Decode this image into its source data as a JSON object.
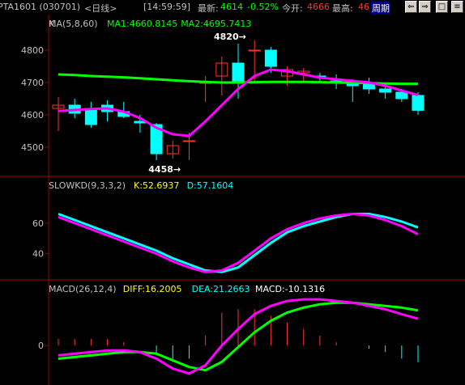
{
  "header": {
    "symbol": "PTA1601 (030701)",
    "period": "<日线>",
    "time": "[14:59:59]",
    "last_label": "最新:",
    "last_value": "4614",
    "change_pct": "-0.52%",
    "open_label": "今开:",
    "open_value": "4666",
    "high_label": "最高:",
    "high_value": "46",
    "period_button": "周期"
  },
  "colors": {
    "up": "#ff3232",
    "down": "#00ffff",
    "ma1": "#ff00ff",
    "ma2": "#00ff00",
    "k": "#ff00ff",
    "d": "#00ffff",
    "diff": "#ff00ff",
    "dea": "#00ff00",
    "axis": "#a00000"
  },
  "chart_data": [
    {
      "type": "candlestick",
      "title": "K",
      "indicator_label": "MA(5,8,60)",
      "legend": [
        {
          "name": "MA1",
          "text": "MA1:4660.8145"
        },
        {
          "name": "MA2",
          "text": "MA2:4695.7413"
        }
      ],
      "ylim": [
        4420,
        4860
      ],
      "yticks": [
        4500,
        4600,
        4700,
        4800
      ],
      "annotations": [
        {
          "text": "4820→",
          "value": 4820
        },
        {
          "text": "4458→",
          "value": 4458
        }
      ],
      "candles": [
        [
          4620,
          4655,
          4550,
          4630
        ],
        [
          4630,
          4650,
          4590,
          4605
        ],
        [
          4620,
          4640,
          4560,
          4570
        ],
        [
          4630,
          4645,
          4580,
          4610
        ],
        [
          4610,
          4640,
          4590,
          4595
        ],
        [
          4580,
          4600,
          4545,
          4575
        ],
        [
          4570,
          4575,
          4460,
          4480
        ],
        [
          4480,
          4520,
          4465,
          4505
        ],
        [
          4520,
          4545,
          4460,
          4520
        ],
        [
          4700,
          4720,
          4640,
          4700
        ],
        [
          4720,
          4780,
          4660,
          4760
        ],
        [
          4760,
          4820,
          4650,
          4700
        ],
        [
          4800,
          4830,
          4700,
          4800
        ],
        [
          4800,
          4810,
          4730,
          4750
        ],
        [
          4720,
          4750,
          4690,
          4740
        ],
        [
          4730,
          4745,
          4700,
          4735
        ],
        [
          4720,
          4730,
          4700,
          4715
        ],
        [
          4705,
          4725,
          4680,
          4700
        ],
        [
          4695,
          4710,
          4640,
          4690
        ],
        [
          4700,
          4715,
          4665,
          4680
        ],
        [
          4680,
          4690,
          4650,
          4670
        ],
        [
          4670,
          4680,
          4640,
          4650
        ],
        [
          4660,
          4670,
          4600,
          4614
        ]
      ],
      "ma1": [
        4612,
        4615,
        4618,
        4620,
        4610,
        4590,
        4560,
        4540,
        4535,
        4580,
        4630,
        4680,
        4720,
        4740,
        4735,
        4725,
        4715,
        4710,
        4705,
        4700,
        4690,
        4675,
        4661
      ],
      "ma2": [
        4725,
        4723,
        4720,
        4718,
        4716,
        4713,
        4710,
        4707,
        4704,
        4702,
        4700,
        4700,
        4701,
        4702,
        4702,
        4702,
        4701,
        4700,
        4699,
        4698,
        4697,
        4696,
        4696
      ]
    },
    {
      "type": "line",
      "title": "SLOWKD(9,3,3,2)",
      "legend": [
        {
          "name": "K",
          "text": "K:52.6937"
        },
        {
          "name": "D",
          "text": "D:57.1604"
        }
      ],
      "ylim": [
        25,
        80
      ],
      "yticks": [
        40,
        60
      ],
      "k": [
        64,
        60,
        56,
        52,
        48,
        44,
        40,
        35,
        31,
        28,
        29,
        34,
        42,
        50,
        56,
        60,
        63,
        65,
        66,
        65,
        62,
        58,
        52.69
      ],
      "d": [
        66,
        62,
        58,
        54,
        50,
        46,
        42,
        37,
        33,
        29,
        28,
        31,
        39,
        47,
        54,
        58,
        61,
        64,
        66,
        66,
        64,
        61,
        57.16
      ]
    },
    {
      "type": "line",
      "title": "MACD(26,12,4)",
      "legend": [
        {
          "name": "DIFF",
          "text": "DIFF:16.2005"
        },
        {
          "name": "DEA",
          "text": "DEA:21.2663"
        },
        {
          "name": "MACD",
          "text": "MACD:-10.1316"
        }
      ],
      "ylim": [
        -22,
        30
      ],
      "yticks": [
        0
      ],
      "diff": [
        -6,
        -5,
        -4,
        -3,
        -3,
        -4,
        -8,
        -14,
        -17,
        -12,
        0,
        10,
        19,
        24,
        27,
        28,
        28,
        27,
        26,
        24,
        22,
        19,
        16.2
      ],
      "dea": [
        -8,
        -7,
        -6,
        -5,
        -4,
        -4,
        -5,
        -9,
        -13,
        -15,
        -10,
        -1,
        8,
        15,
        20,
        23,
        25,
        26,
        26,
        25,
        24,
        23,
        21.27
      ],
      "macd": [
        4,
        4,
        4,
        4,
        2,
        0,
        -6,
        -10,
        -8,
        6,
        20,
        22,
        22,
        18,
        14,
        10,
        6,
        2,
        0,
        -2,
        -4,
        -8,
        -10.13
      ]
    }
  ]
}
